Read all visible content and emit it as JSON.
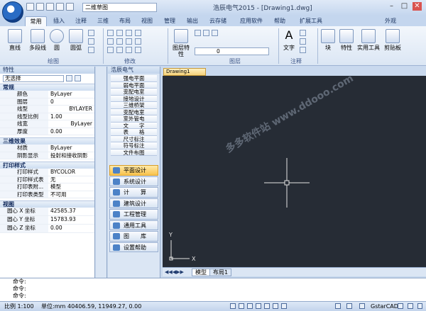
{
  "app": {
    "title": "浩辰电气2015 - [Drawing1.dwg]",
    "workspace": "二维草图"
  },
  "tabs": [
    "常用",
    "插入",
    "注释",
    "三维",
    "布局",
    "视图",
    "管理",
    "输出",
    "云存储",
    "应用软件",
    "帮助",
    "扩展工具"
  ],
  "tabs_right": "外观",
  "ribbon": {
    "draw_group": "绘图",
    "modify_group": "修改",
    "layer_group": "图层",
    "annot_group": "注释",
    "buttons": {
      "line": "直线",
      "polyline": "多段线",
      "circle": "圆",
      "arc": "圆弧",
      "layer_props": "图层特性",
      "text": "文字",
      "block": "块",
      "properties": "特性",
      "utilities": "实用工具",
      "clipboard": "剪贴板"
    },
    "layer_value": "0"
  },
  "props": {
    "title": "特性",
    "selection": "无选择",
    "sections": {
      "general": {
        "label": "常规",
        "rows": [
          [
            "颜色",
            "ByLayer"
          ],
          [
            "图层",
            "0"
          ],
          [
            "线型",
            "BYLAYER"
          ],
          [
            "线型比例",
            "1.00"
          ],
          [
            "线宽",
            "ByLayer"
          ],
          [
            "厚度",
            "0.00"
          ]
        ]
      },
      "threed": {
        "label": "三维效果",
        "rows": [
          [
            "材质",
            "ByLayer"
          ],
          [
            "阴影显示",
            "投射和接收阴影"
          ]
        ]
      },
      "plot": {
        "label": "打印样式",
        "rows": [
          [
            "打印样式",
            "BYCOLOR"
          ],
          [
            "打印样式表",
            "无"
          ],
          [
            "打印表附...",
            "模型"
          ],
          [
            "打印表类型",
            "不可用"
          ]
        ]
      },
      "view": {
        "label": "视图",
        "rows": [
          [
            "圆心 X 坐标",
            "42585.37"
          ],
          [
            "圆心 Y 坐标",
            "15783.93"
          ],
          [
            "圆心 Z 坐标",
            "0.00"
          ]
        ]
      }
    }
  },
  "elec": {
    "title": "浩辰电气",
    "items": [
      "强电平面",
      "弱电平面",
      "变配电室",
      "接地设计",
      "三维桥架",
      "变配电室",
      "室外管电",
      "文　　字",
      "表　　格",
      "尺寸标注",
      "符号标注",
      "文件布图"
    ],
    "nav": [
      "平面设计",
      "系统设计",
      "计　　算",
      "建筑设计",
      "工程管理",
      "通用工具",
      "图　　库",
      "设置帮助"
    ],
    "active_nav": 0
  },
  "doc": {
    "tab": "Drawing1",
    "layout_tabs": [
      "模型",
      "布局1"
    ]
  },
  "command": {
    "lines": [
      "命令:",
      "命令:",
      "命令:"
    ]
  },
  "status": {
    "scale": "比例 1:100",
    "unit": "单位:mm",
    "coords": "40406.59, 11949.27, 0.00",
    "brand": "GstarCAD"
  },
  "watermark": "多多软件站 www.ddooo.com"
}
